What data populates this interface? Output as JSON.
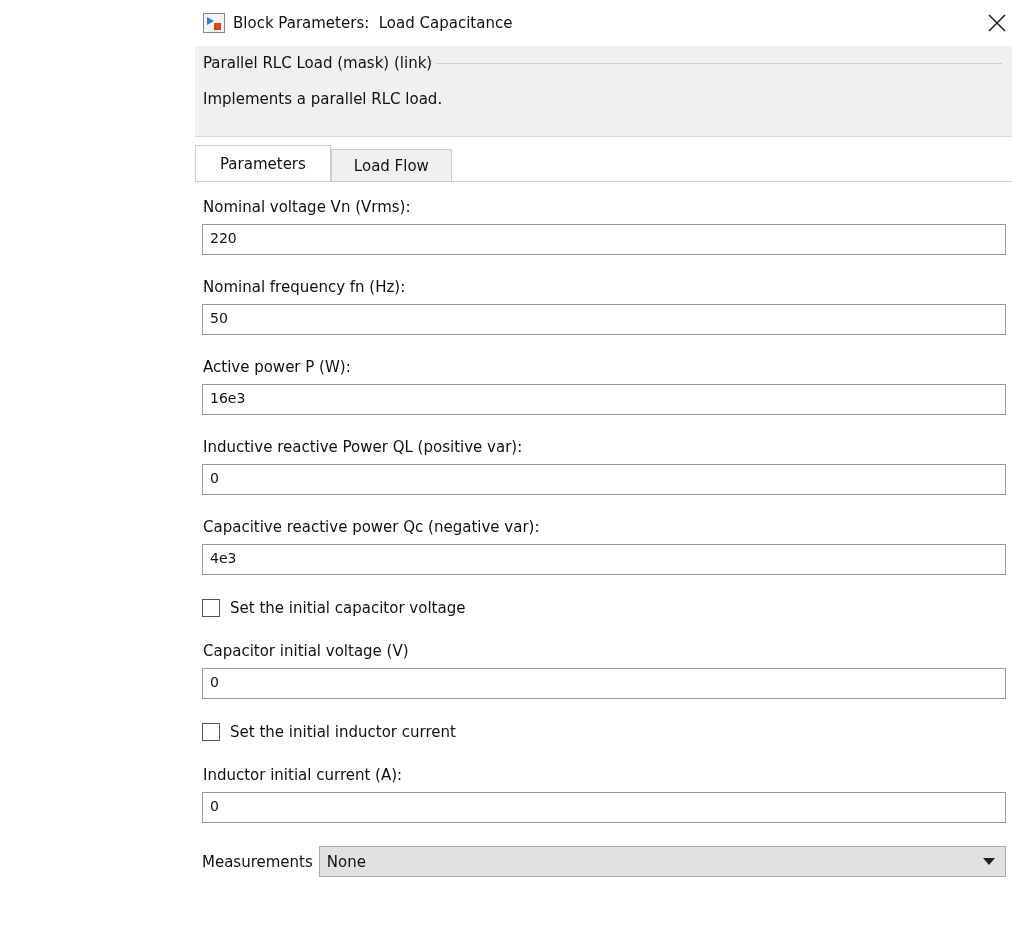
{
  "window": {
    "title": "Block Parameters:  Load Capacitance"
  },
  "description": {
    "group_title": "Parallel RLC Load (mask) (link)",
    "text": "Implements a parallel RLC load."
  },
  "tabs": [
    {
      "label": "Parameters",
      "selected": true
    },
    {
      "label": "Load Flow",
      "selected": false
    }
  ],
  "parameters": [
    {
      "kind": "field",
      "label": "Nominal voltage Vn (Vrms):",
      "value": "220"
    },
    {
      "kind": "field",
      "label": "Nominal frequency fn (Hz):",
      "value": "50"
    },
    {
      "kind": "field",
      "label": "Active power P (W):",
      "value": "16e3"
    },
    {
      "kind": "field",
      "label": "Inductive reactive Power QL (positive var):",
      "value": "0"
    },
    {
      "kind": "field",
      "label": "Capacitive reactive power Qc (negative var):",
      "value": "4e3"
    },
    {
      "kind": "checkbox",
      "label": "Set the initial capacitor voltage",
      "checked": false
    },
    {
      "kind": "field",
      "label": "Capacitor initial voltage (V)",
      "value": "0"
    },
    {
      "kind": "checkbox",
      "label": "Set the initial inductor current",
      "checked": false
    },
    {
      "kind": "field",
      "label": "Inductor initial current (A):",
      "value": "0"
    },
    {
      "kind": "dropdown",
      "label": "Measurements",
      "value": "None"
    }
  ]
}
